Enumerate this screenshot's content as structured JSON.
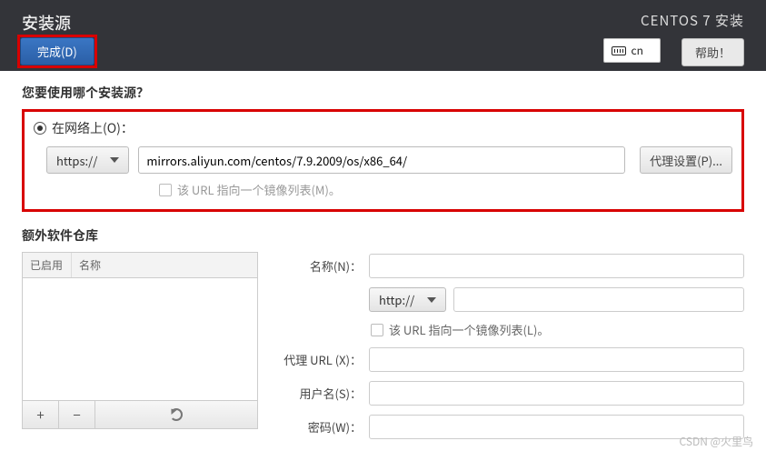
{
  "header": {
    "title": "安装源",
    "done_label": "完成(D)",
    "installer_title": "CENTOS 7 安装",
    "keyboard_layout": "cn",
    "help_label": "帮助！"
  },
  "main": {
    "prompt": "您要使用哪个安装源？",
    "radio_network_label": "在网络上(O)：",
    "protocol_selected": "https://",
    "url_value": "mirrors.aliyun.com/centos/7.9.2009/os/x86_64/",
    "proxy_button": "代理设置(P)...",
    "mirrorlist_label": "该 URL 指向一个镜像列表(M)。"
  },
  "extra_repos": {
    "section_label": "额外软件仓库",
    "columns": {
      "enabled": "已启用",
      "name": "名称"
    },
    "buttons": {
      "add": "+",
      "remove": "−"
    }
  },
  "repo_form": {
    "name_label": "名称(N)：",
    "protocol_selected": "http://",
    "mirrorlist_label": "该 URL 指向一个镜像列表(L)。",
    "proxy_url_label": "代理 URL (X)：",
    "user_label": "用户名(S)：",
    "password_label": "密码(W)："
  },
  "watermark": "CSDN @火里鸟"
}
